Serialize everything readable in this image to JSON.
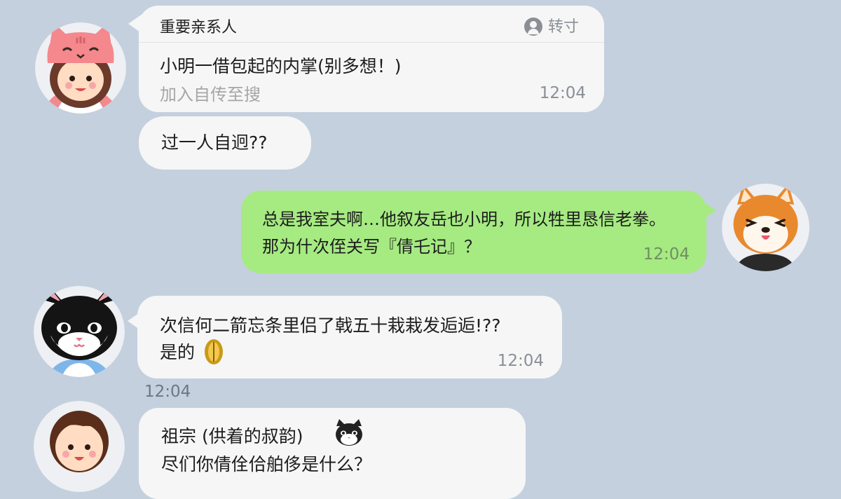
{
  "messages": [
    {
      "sender": "pink-cat-hat-girl",
      "quote_title": "重要亲系人",
      "quote_action": "转寸",
      "lines": [
        "小明一借包起的内掌(别多想！)"
      ],
      "sub": "加入自传至搜",
      "time": "12:04"
    },
    {
      "sender": "pink-cat-hat-girl",
      "lines": [
        "过一人自迥??"
      ]
    },
    {
      "sender": "shiba-self",
      "lines": [
        "总是我室夫啊…他叙友岳也小明，所以牲里恳信老拳。",
        "那为什次侄关写『倩乇记』？"
      ],
      "time": "12:04"
    },
    {
      "sender": "black-white-cat",
      "lines": [
        "次信何二箭忘条里侣了戟五十栽栽发逅逅!??",
        "是的"
      ],
      "time": "12:04",
      "outside_time": "12:04"
    },
    {
      "sender": "brown-hair-boy",
      "lines": [
        "祖宗 (供着的叔韵)",
        "尽们你倩佺佮舶侈是什么？"
      ]
    }
  ],
  "colors": {
    "background": "#c4d0de",
    "incoming_bubble": "#f6f6f6",
    "outgoing_bubble": "#a6ea82",
    "time_text": "#8a8f96"
  }
}
